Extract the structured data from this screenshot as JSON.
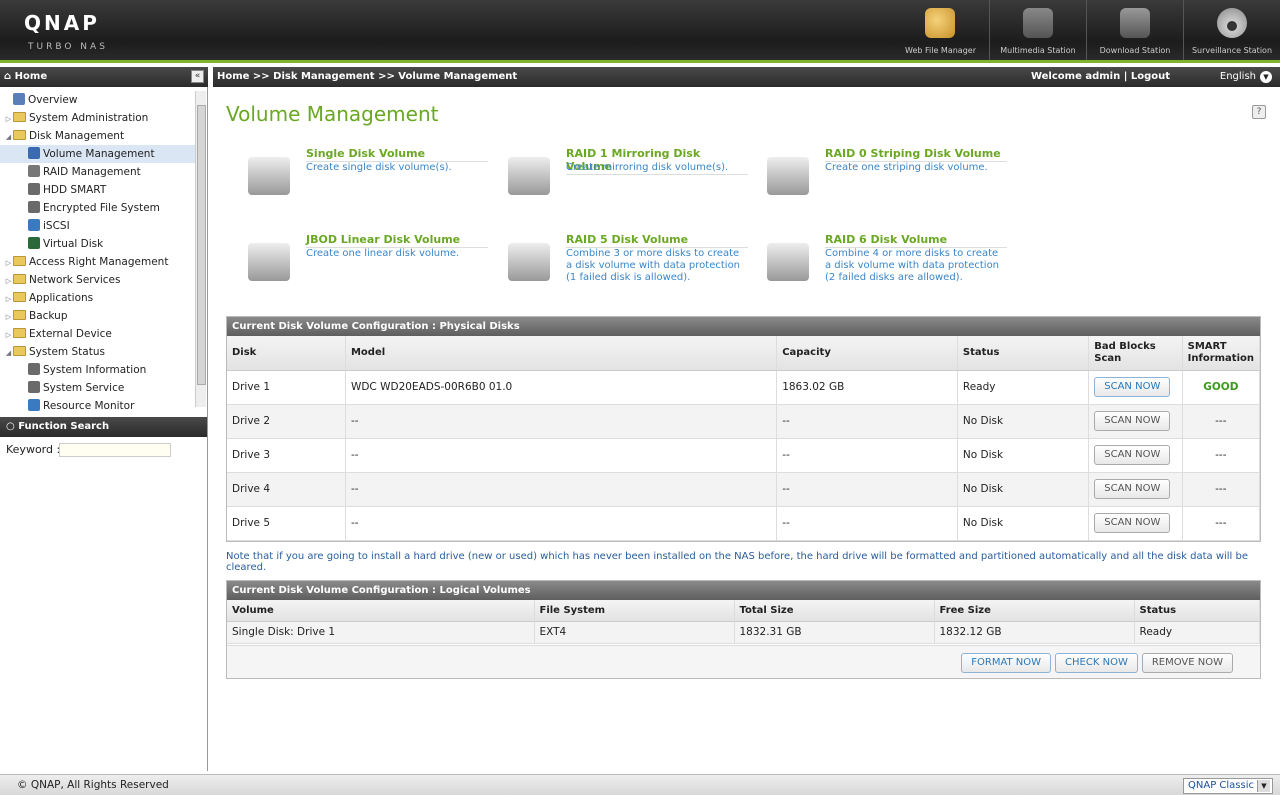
{
  "header": {
    "logo": "QNAP",
    "logo_sub": "TURBO NAS",
    "apps": [
      {
        "label": "Web File Manager",
        "icon": "file-manager-icon"
      },
      {
        "label": "Multimedia Station",
        "icon": "multimedia-icon"
      },
      {
        "label": "Download Station",
        "icon": "download-icon"
      },
      {
        "label": "Surveillance Station",
        "icon": "camera-icon"
      }
    ]
  },
  "topbar": {
    "home": "Home",
    "breadcrumb": "Home >> Disk Management >> Volume Management",
    "welcome": "Welcome admin | Logout",
    "language": "English"
  },
  "sidebar": {
    "items": [
      {
        "label": "Overview",
        "level": 0,
        "type": "leaf"
      },
      {
        "label": "System Administration",
        "level": 0,
        "type": "folder"
      },
      {
        "label": "Disk Management",
        "level": 0,
        "type": "folder-open"
      },
      {
        "label": "Volume Management",
        "level": 1,
        "type": "leaf",
        "selected": true
      },
      {
        "label": "RAID Management",
        "level": 1,
        "type": "leaf"
      },
      {
        "label": "HDD SMART",
        "level": 1,
        "type": "leaf"
      },
      {
        "label": "Encrypted File System",
        "level": 1,
        "type": "leaf"
      },
      {
        "label": "iSCSI",
        "level": 1,
        "type": "leaf"
      },
      {
        "label": "Virtual Disk",
        "level": 1,
        "type": "leaf"
      },
      {
        "label": "Access Right Management",
        "level": 0,
        "type": "folder"
      },
      {
        "label": "Network Services",
        "level": 0,
        "type": "folder"
      },
      {
        "label": "Applications",
        "level": 0,
        "type": "folder"
      },
      {
        "label": "Backup",
        "level": 0,
        "type": "folder"
      },
      {
        "label": "External Device",
        "level": 0,
        "type": "folder"
      },
      {
        "label": "System Status",
        "level": 0,
        "type": "folder-open"
      },
      {
        "label": "System Information",
        "level": 1,
        "type": "leaf"
      },
      {
        "label": "System Service",
        "level": 1,
        "type": "leaf"
      },
      {
        "label": "Resource Monitor",
        "level": 1,
        "type": "leaf"
      }
    ],
    "function_search": "Function Search",
    "keyword_label": "Keyword :"
  },
  "main": {
    "title": "Volume Management",
    "tiles": [
      {
        "title": "Single Disk Volume",
        "desc": "Create single disk volume(s)."
      },
      {
        "title": "RAID 1 Mirroring Disk Volume",
        "desc": "Create mirroring disk volume(s)."
      },
      {
        "title": "RAID 0 Striping Disk Volume",
        "desc": "Create one striping disk volume."
      },
      {
        "title": "JBOD Linear Disk Volume",
        "desc": "Create one linear disk volume."
      },
      {
        "title": "RAID 5 Disk Volume",
        "desc": "Combine 3 or more disks to create a disk volume with data protection (1 failed disk is allowed)."
      },
      {
        "title": "RAID 6 Disk Volume",
        "desc": "Combine 4 or more disks to create a disk volume with data protection (2 failed disks are allowed)."
      }
    ],
    "physical": {
      "caption": "Current Disk Volume Configuration : Physical Disks",
      "headers": [
        "Disk",
        "Model",
        "Capacity",
        "Status",
        "Bad Blocks Scan",
        "SMART Information"
      ],
      "scan_label": "SCAN NOW",
      "rows": [
        {
          "disk": "Drive 1",
          "model": "WDC WD20EADS-00R6B0 01.0",
          "capacity": "1863.02 GB",
          "status": "Ready",
          "smart": "GOOD"
        },
        {
          "disk": "Drive 2",
          "model": "--",
          "capacity": "--",
          "status": "No Disk",
          "smart": "---"
        },
        {
          "disk": "Drive 3",
          "model": "--",
          "capacity": "--",
          "status": "No Disk",
          "smart": "---"
        },
        {
          "disk": "Drive 4",
          "model": "--",
          "capacity": "--",
          "status": "No Disk",
          "smart": "---"
        },
        {
          "disk": "Drive 5",
          "model": "--",
          "capacity": "--",
          "status": "No Disk",
          "smart": "---"
        }
      ]
    },
    "note": "Note that if you are going to install a hard drive (new or used) which has never been installed on the NAS before, the hard drive will be formatted and partitioned automatically and all the disk data will be cleared.",
    "logical": {
      "caption": "Current Disk Volume Configuration : Logical Volumes",
      "headers": [
        "Volume",
        "File System",
        "Total Size",
        "Free Size",
        "Status"
      ],
      "rows": [
        {
          "volume": "Single Disk: Drive 1",
          "fs": "EXT4",
          "total": "1832.31 GB",
          "free": "1832.12 GB",
          "status": "Ready"
        }
      ],
      "buttons": {
        "format": "FORMAT NOW",
        "check": "CHECK NOW",
        "remove": "REMOVE NOW"
      }
    }
  },
  "footer": {
    "copyright": "© QNAP, All Rights Reserved",
    "theme": "QNAP Classic"
  }
}
